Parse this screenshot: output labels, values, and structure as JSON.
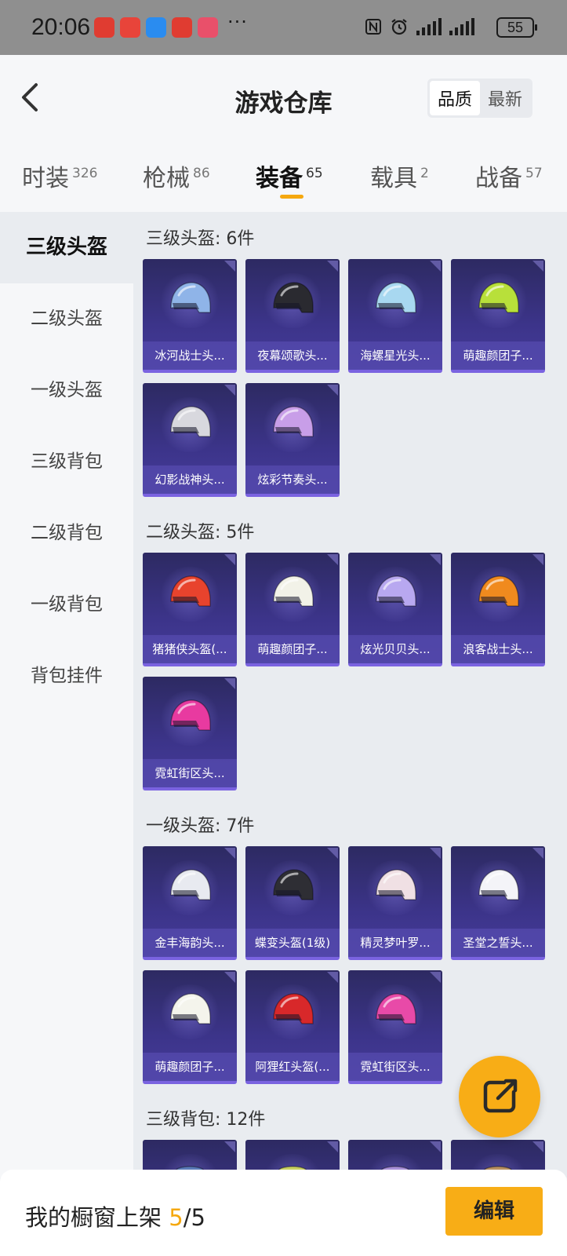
{
  "status_bar": {
    "time": "20:06",
    "more": "···",
    "battery": "55",
    "icons": [
      "nfc-icon",
      "alarm-icon",
      "signal-icon",
      "signal-icon-2"
    ],
    "app_colors": [
      "#e03c31",
      "#e8443a",
      "#2a8cf0",
      "#e03c31",
      "#e9506a"
    ]
  },
  "header": {
    "title": "游戏仓库",
    "sort_options": [
      "品质",
      "最新"
    ],
    "sort_active": "品质"
  },
  "tabs": [
    {
      "label": "时装",
      "count": "326"
    },
    {
      "label": "枪械",
      "count": "86"
    },
    {
      "label": "装备",
      "count": "65",
      "active": true
    },
    {
      "label": "载具",
      "count": "2"
    },
    {
      "label": "战备",
      "count": "57"
    }
  ],
  "sidebar": {
    "items": [
      "三级头盔",
      "二级头盔",
      "一级头盔",
      "三级背包",
      "二级背包",
      "一级背包",
      "背包挂件"
    ],
    "active": "三级头盔"
  },
  "sections": [
    {
      "title": "三级头盔: 6件",
      "items": [
        {
          "name": "冰河战士头...",
          "color": "#8fb4e8"
        },
        {
          "name": "夜幕颂歌头...",
          "color": "#2a2a30"
        },
        {
          "name": "海螺星光头...",
          "color": "#a8d8f0"
        },
        {
          "name": "萌趣颜团子...",
          "color": "#b8e03a"
        },
        {
          "name": "幻影战神头...",
          "color": "#d8d8de"
        },
        {
          "name": "炫彩节奏头...",
          "color": "#c89ee8"
        }
      ]
    },
    {
      "title": "二级头盔: 5件",
      "items": [
        {
          "name": "猪猪侠头盔(...",
          "color": "#e8432d"
        },
        {
          "name": "萌趣颜团子...",
          "color": "#f2f2e8"
        },
        {
          "name": "炫光贝贝头...",
          "color": "#b8a8f0"
        },
        {
          "name": "浪客战士头...",
          "color": "#f08a1e"
        },
        {
          "name": "霓虹街区头...",
          "color": "#e83aa0"
        }
      ]
    },
    {
      "title": "一级头盔: 7件",
      "items": [
        {
          "name": "金丰海韵头...",
          "color": "#e8eaf0"
        },
        {
          "name": "蝶变头盔(1级)",
          "color": "#2e2e34"
        },
        {
          "name": "精灵梦叶罗...",
          "color": "#f0e0e4"
        },
        {
          "name": "圣堂之誓头...",
          "color": "#f4f4f8"
        },
        {
          "name": "萌趣颜团子...",
          "color": "#f4f4ec"
        },
        {
          "name": "阿狸红头盔(...",
          "color": "#d8282a"
        },
        {
          "name": "霓虹街区头...",
          "color": "#e84aa8"
        }
      ]
    },
    {
      "title": "三级背包: 12件",
      "items": [
        {
          "name": "",
          "color": "#5a7ab8"
        },
        {
          "name": "",
          "color": "#c8d060"
        },
        {
          "name": "",
          "color": "#a890d8"
        },
        {
          "name": "",
          "color": "#b89060"
        }
      ]
    }
  ],
  "bottom_bar": {
    "label": "我的橱窗上架",
    "count_current": "5",
    "count_total": "/5",
    "edit_label": "编辑"
  }
}
